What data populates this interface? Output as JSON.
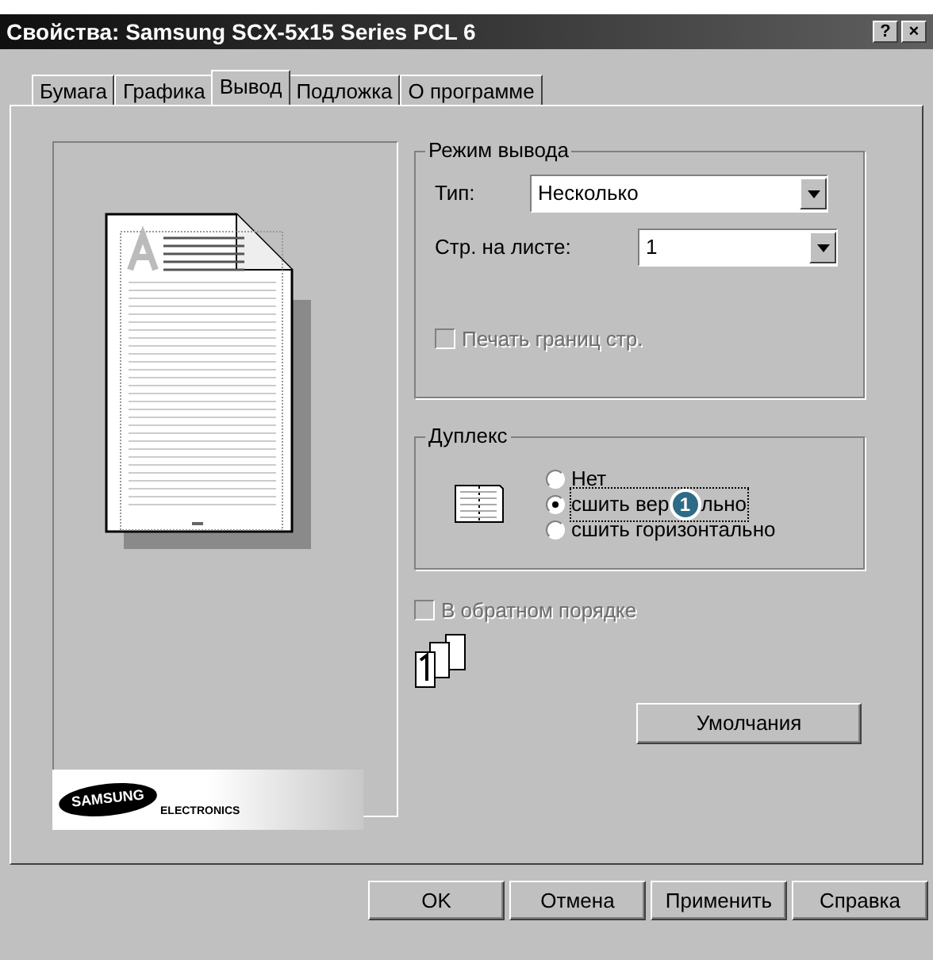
{
  "window": {
    "title": "Свойства: Samsung SCX-5x15 Series PCL 6",
    "title_buttons": [
      "?",
      "×"
    ]
  },
  "tabs": [
    {
      "label": "Бумага",
      "selected": false
    },
    {
      "label": "Графика",
      "selected": false
    },
    {
      "label": "Вывод",
      "selected": true
    },
    {
      "label": "Подложка",
      "selected": false
    },
    {
      "label": "О программе",
      "selected": false
    }
  ],
  "output_mode": {
    "title": "Режим вывода",
    "type_label": "Тип:",
    "type_value": "Несколько",
    "pages_label": "Стр. на листе:",
    "pages_value": "1",
    "border_checkbox": {
      "label": "Печать границ стр.",
      "checked": false,
      "disabled": true
    }
  },
  "duplex": {
    "title": "Дуплекс",
    "options": [
      {
        "label": "Нет",
        "selected": false
      },
      {
        "label": "сшить вер",
        "label_after": "льно",
        "callout": "1",
        "selected": true
      },
      {
        "label": "сшить горизонтально",
        "selected": false
      }
    ]
  },
  "reverse_checkbox": {
    "label": "В обратном порядке",
    "checked": false,
    "disabled": true
  },
  "defaults_button": "Умолчания",
  "logo": {
    "brand": "SAMSUNG",
    "subtitle": "ELECTRONICS"
  },
  "buttons": [
    "OK",
    "Отмена",
    "Применить",
    "Справка"
  ]
}
